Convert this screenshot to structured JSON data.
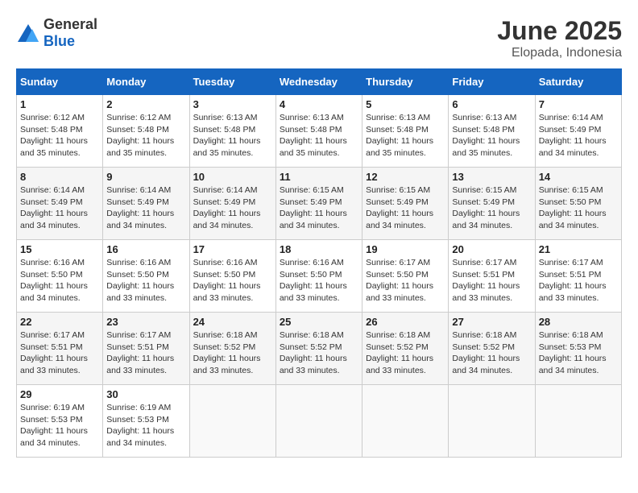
{
  "header": {
    "logo_general": "General",
    "logo_blue": "Blue",
    "month": "June 2025",
    "location": "Elopada, Indonesia"
  },
  "weekdays": [
    "Sunday",
    "Monday",
    "Tuesday",
    "Wednesday",
    "Thursday",
    "Friday",
    "Saturday"
  ],
  "weeks": [
    [
      {
        "day": "1",
        "sunrise": "6:12 AM",
        "sunset": "5:48 PM",
        "daylight": "11 hours and 35 minutes."
      },
      {
        "day": "2",
        "sunrise": "6:12 AM",
        "sunset": "5:48 PM",
        "daylight": "11 hours and 35 minutes."
      },
      {
        "day": "3",
        "sunrise": "6:13 AM",
        "sunset": "5:48 PM",
        "daylight": "11 hours and 35 minutes."
      },
      {
        "day": "4",
        "sunrise": "6:13 AM",
        "sunset": "5:48 PM",
        "daylight": "11 hours and 35 minutes."
      },
      {
        "day": "5",
        "sunrise": "6:13 AM",
        "sunset": "5:48 PM",
        "daylight": "11 hours and 35 minutes."
      },
      {
        "day": "6",
        "sunrise": "6:13 AM",
        "sunset": "5:48 PM",
        "daylight": "11 hours and 35 minutes."
      },
      {
        "day": "7",
        "sunrise": "6:14 AM",
        "sunset": "5:49 PM",
        "daylight": "11 hours and 34 minutes."
      }
    ],
    [
      {
        "day": "8",
        "sunrise": "6:14 AM",
        "sunset": "5:49 PM",
        "daylight": "11 hours and 34 minutes."
      },
      {
        "day": "9",
        "sunrise": "6:14 AM",
        "sunset": "5:49 PM",
        "daylight": "11 hours and 34 minutes."
      },
      {
        "day": "10",
        "sunrise": "6:14 AM",
        "sunset": "5:49 PM",
        "daylight": "11 hours and 34 minutes."
      },
      {
        "day": "11",
        "sunrise": "6:15 AM",
        "sunset": "5:49 PM",
        "daylight": "11 hours and 34 minutes."
      },
      {
        "day": "12",
        "sunrise": "6:15 AM",
        "sunset": "5:49 PM",
        "daylight": "11 hours and 34 minutes."
      },
      {
        "day": "13",
        "sunrise": "6:15 AM",
        "sunset": "5:49 PM",
        "daylight": "11 hours and 34 minutes."
      },
      {
        "day": "14",
        "sunrise": "6:15 AM",
        "sunset": "5:50 PM",
        "daylight": "11 hours and 34 minutes."
      }
    ],
    [
      {
        "day": "15",
        "sunrise": "6:16 AM",
        "sunset": "5:50 PM",
        "daylight": "11 hours and 34 minutes."
      },
      {
        "day": "16",
        "sunrise": "6:16 AM",
        "sunset": "5:50 PM",
        "daylight": "11 hours and 33 minutes."
      },
      {
        "day": "17",
        "sunrise": "6:16 AM",
        "sunset": "5:50 PM",
        "daylight": "11 hours and 33 minutes."
      },
      {
        "day": "18",
        "sunrise": "6:16 AM",
        "sunset": "5:50 PM",
        "daylight": "11 hours and 33 minutes."
      },
      {
        "day": "19",
        "sunrise": "6:17 AM",
        "sunset": "5:50 PM",
        "daylight": "11 hours and 33 minutes."
      },
      {
        "day": "20",
        "sunrise": "6:17 AM",
        "sunset": "5:51 PM",
        "daylight": "11 hours and 33 minutes."
      },
      {
        "day": "21",
        "sunrise": "6:17 AM",
        "sunset": "5:51 PM",
        "daylight": "11 hours and 33 minutes."
      }
    ],
    [
      {
        "day": "22",
        "sunrise": "6:17 AM",
        "sunset": "5:51 PM",
        "daylight": "11 hours and 33 minutes."
      },
      {
        "day": "23",
        "sunrise": "6:17 AM",
        "sunset": "5:51 PM",
        "daylight": "11 hours and 33 minutes."
      },
      {
        "day": "24",
        "sunrise": "6:18 AM",
        "sunset": "5:52 PM",
        "daylight": "11 hours and 33 minutes."
      },
      {
        "day": "25",
        "sunrise": "6:18 AM",
        "sunset": "5:52 PM",
        "daylight": "11 hours and 33 minutes."
      },
      {
        "day": "26",
        "sunrise": "6:18 AM",
        "sunset": "5:52 PM",
        "daylight": "11 hours and 33 minutes."
      },
      {
        "day": "27",
        "sunrise": "6:18 AM",
        "sunset": "5:52 PM",
        "daylight": "11 hours and 34 minutes."
      },
      {
        "day": "28",
        "sunrise": "6:18 AM",
        "sunset": "5:53 PM",
        "daylight": "11 hours and 34 minutes."
      }
    ],
    [
      {
        "day": "29",
        "sunrise": "6:19 AM",
        "sunset": "5:53 PM",
        "daylight": "11 hours and 34 minutes."
      },
      {
        "day": "30",
        "sunrise": "6:19 AM",
        "sunset": "5:53 PM",
        "daylight": "11 hours and 34 minutes."
      },
      null,
      null,
      null,
      null,
      null
    ]
  ]
}
